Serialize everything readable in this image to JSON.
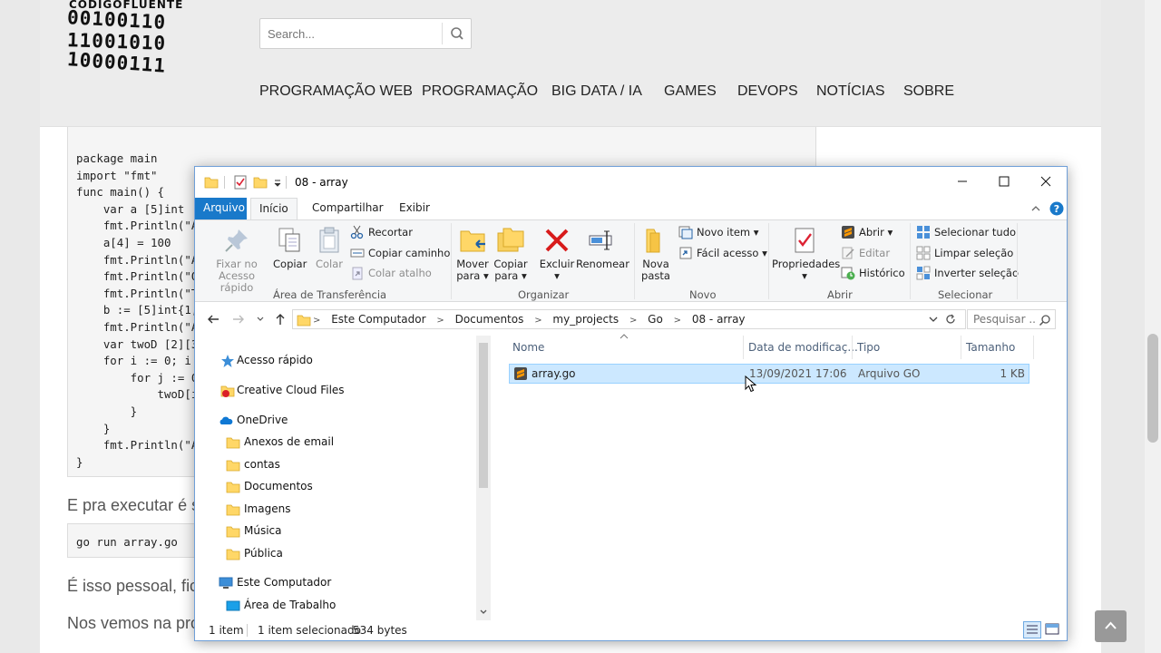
{
  "site": {
    "logo_brand": "CÓDIGOFLUENTE",
    "logo_lines": [
      "00100110",
      "11001010",
      "10000111"
    ],
    "search_placeholder": "Search...",
    "nav": [
      "PROGRAMAÇÃO WEB",
      "PROGRAMAÇÃO",
      "BIG DATA / IA",
      "GAMES",
      "DEVOPS",
      "NOTÍCIAS",
      "SOBRE"
    ],
    "code_lines": [
      "package main",
      "import \"fmt\"",
      "func main() {",
      "    var a [5]int",
      "    fmt.Println(\"Ar",
      "    a[4] = 100",
      "    fmt.Println(\"Ar",
      "    fmt.Println(\"O",
      "    fmt.Println(\"T",
      "    b := [5]int{1,",
      "    fmt.Println(\"Ar",
      "    var twoD [2][3",
      "    for i := 0; i ",
      "        for j := 0",
      "            twoD[i",
      "        }",
      "    }",
      "    fmt.Println(\"Ar",
      "}"
    ],
    "text_run": "E pra executar é s",
    "run_command": "go run array.go",
    "text_outro": "É isso pessoal, fic",
    "text_bye": "Nos vemos na pro"
  },
  "explorer": {
    "title": "08 - array",
    "tabs": [
      "Arquivo",
      "Início",
      "Compartilhar",
      "Exibir"
    ],
    "ribbon": {
      "clipboard": {
        "pin_label_1": "Fixar no",
        "pin_label_2": "Acesso rápido",
        "copy": "Copiar",
        "paste": "Colar",
        "cut": "Recortar",
        "copy_path": "Copiar caminho",
        "paste_shortcut": "Colar atalho",
        "group": "Área de Transferência"
      },
      "organize": {
        "move_1": "Mover",
        "move_2": "para",
        "copy_1": "Copiar",
        "copy_2": "para",
        "delete": "Excluir",
        "rename": "Renomear",
        "group": "Organizar"
      },
      "new": {
        "new_folder_1": "Nova",
        "new_folder_2": "pasta",
        "new_item": "Novo item",
        "easy_access": "Fácil acesso",
        "group": "Novo"
      },
      "open": {
        "properties": "Propriedades",
        "open": "Abrir",
        "edit": "Editar",
        "history": "Histórico",
        "group": "Abrir"
      },
      "select": {
        "select_all": "Selecionar tudo",
        "clear": "Limpar seleção",
        "invert": "Inverter seleção",
        "group": "Selecionar"
      }
    },
    "breadcrumbs": [
      "Este Computador",
      "Documentos",
      "my_projects",
      "Go",
      "08 - array"
    ],
    "search_placeholder": "Pesquisar ...",
    "nav_pane": {
      "quick_access": "Acesso rápido",
      "creative_cloud": "Creative Cloud Files",
      "onedrive": "OneDrive",
      "folders": [
        "Anexos de email",
        "contas",
        "Documentos",
        "Imagens",
        "Música",
        "Pública"
      ],
      "this_pc": "Este Computador",
      "desktop": "Área de Trabalho"
    },
    "columns": [
      "Nome",
      "Data de modificaç...",
      "Tipo",
      "Tamanho"
    ],
    "files": [
      {
        "name": "array.go",
        "modified": "13/09/2021 17:06",
        "type": "Arquivo GO",
        "size": "1 KB"
      }
    ],
    "status": {
      "count": "1 item",
      "selected": "1 item selecionado",
      "bytes": "534 bytes"
    },
    "colors": {
      "accent": "#1979ca",
      "selection": "#cce8ff",
      "folder": "#ffd767"
    }
  }
}
